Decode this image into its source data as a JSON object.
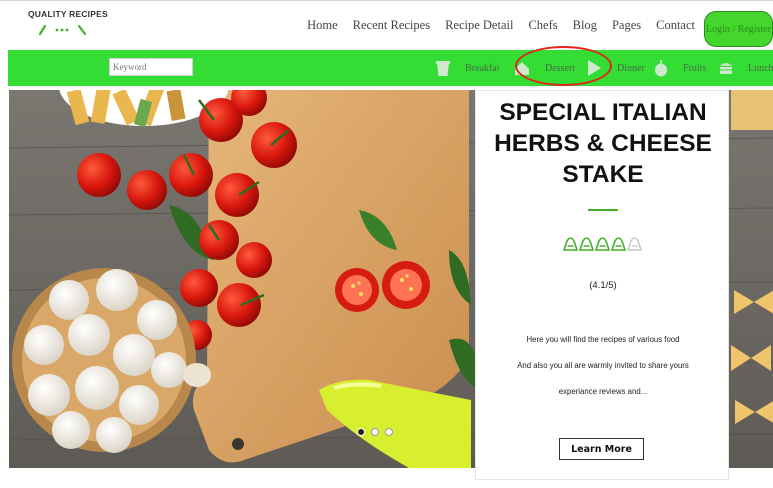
{
  "brand": {
    "name": "QUALITY RECIPES"
  },
  "nav": {
    "items": [
      "Home",
      "Recent Recipes",
      "Recipe Detail",
      "Chefs",
      "Blog",
      "Pages",
      "Contact"
    ],
    "login_label": "Login / Register"
  },
  "search": {
    "placeholder": "Keyword"
  },
  "categories": [
    {
      "label": "Breakfast",
      "icon": "coffee-cup-icon"
    },
    {
      "label": "Dessert",
      "icon": "cake-icon"
    },
    {
      "label": "Dinner",
      "icon": "pizza-slice-icon"
    },
    {
      "label": "Fruits",
      "icon": "apple-icon"
    },
    {
      "label": "Lunch",
      "icon": "burger-icon"
    }
  ],
  "hero": {
    "title_lines": [
      "SPECIAL ITALIAN",
      "HERBS & CHEESE",
      "STAKE"
    ],
    "rating_value": 4.1,
    "rating_max": 5,
    "rating_text": "(4.1/5)",
    "description": [
      "Here you will find the recipes of various food",
      "And also you all are warmly invited to share yours",
      "experiance reviews and..."
    ],
    "cta_label": "Learn More",
    "slides_total": 3,
    "active_slide": 1
  },
  "colors": {
    "accent_green": "#33dd33",
    "highlight_red": "#e0261c",
    "rating_green": "#43b02a"
  }
}
